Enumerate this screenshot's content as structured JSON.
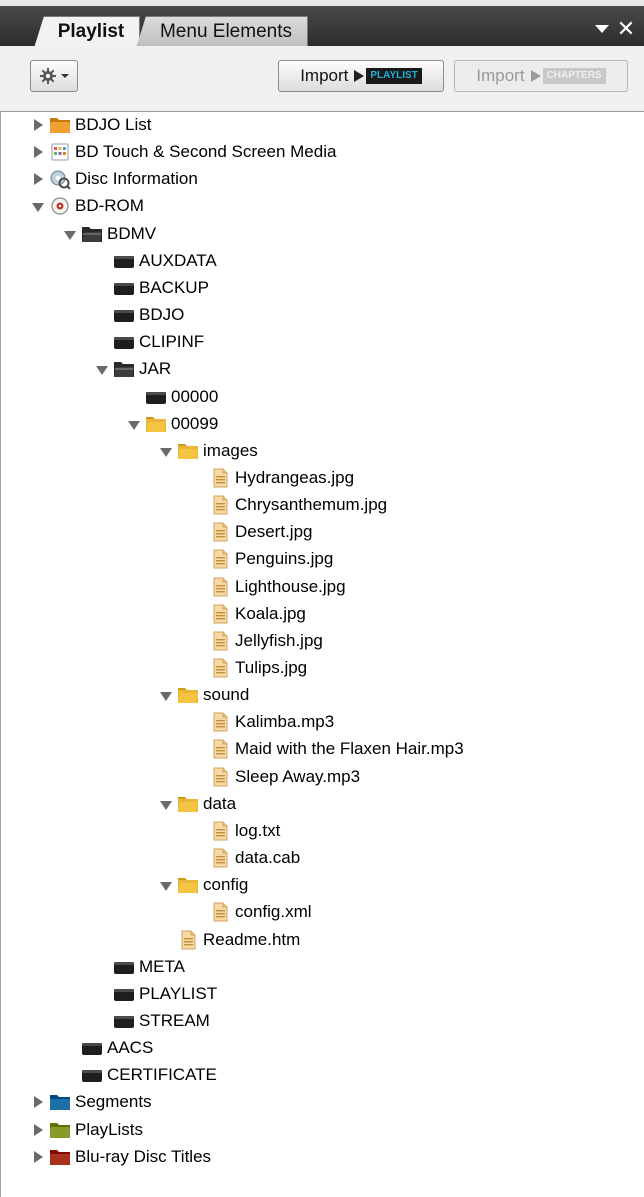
{
  "tabs": [
    {
      "label": "Playlist",
      "active": true
    },
    {
      "label": "Menu Elements",
      "active": false
    }
  ],
  "toolbar": {
    "settings_icon": "gear-icon",
    "import_label": "Import",
    "playlist_badge": "PLAYLIST",
    "chapters_badge": "CHAPTERS"
  },
  "colors": {
    "tabbar": "#2c2c2c",
    "folder_yellow": "#f5c542",
    "bdjo_orange": "#f0a030",
    "segments_blue": "#1d6fa8",
    "playlists_green": "#8a9a2a",
    "titles_red": "#a8321d",
    "playlist_badge_text": "#1fb0d8"
  },
  "tree": [
    {
      "label": "BDJO List",
      "level": 0,
      "state": "collapsed",
      "icon": "bdjo-folder-icon"
    },
    {
      "label": "BD Touch & Second Screen Media",
      "level": 0,
      "state": "collapsed",
      "icon": "touch-media-icon"
    },
    {
      "label": "Disc Information",
      "level": 0,
      "state": "collapsed",
      "icon": "disc-info-icon"
    },
    {
      "label": "BD-ROM",
      "level": 0,
      "state": "expanded",
      "icon": "disc-icon"
    },
    {
      "label": "BDMV",
      "level": 1,
      "state": "expanded",
      "icon": "dark-folder-open-icon"
    },
    {
      "label": "AUXDATA",
      "level": 2,
      "state": "none",
      "icon": "dark-folder-icon"
    },
    {
      "label": "BACKUP",
      "level": 2,
      "state": "none",
      "icon": "dark-folder-icon"
    },
    {
      "label": "BDJO",
      "level": 2,
      "state": "none",
      "icon": "dark-folder-icon"
    },
    {
      "label": "CLIPINF",
      "level": 2,
      "state": "none",
      "icon": "dark-folder-icon"
    },
    {
      "label": "JAR",
      "level": 2,
      "state": "expanded",
      "icon": "dark-folder-open-icon"
    },
    {
      "label": "00000",
      "level": 3,
      "state": "none",
      "icon": "dark-folder-icon"
    },
    {
      "label": "00099",
      "level": 3,
      "state": "expanded",
      "icon": "folder-open-icon"
    },
    {
      "label": "images",
      "level": 4,
      "state": "expanded",
      "icon": "folder-open-icon"
    },
    {
      "label": "Hydrangeas.jpg",
      "level": 5,
      "state": "none",
      "icon": "file-icon"
    },
    {
      "label": "Chrysanthemum.jpg",
      "level": 5,
      "state": "none",
      "icon": "file-icon"
    },
    {
      "label": "Desert.jpg",
      "level": 5,
      "state": "none",
      "icon": "file-icon"
    },
    {
      "label": "Penguins.jpg",
      "level": 5,
      "state": "none",
      "icon": "file-icon"
    },
    {
      "label": "Lighthouse.jpg",
      "level": 5,
      "state": "none",
      "icon": "file-icon"
    },
    {
      "label": "Koala.jpg",
      "level": 5,
      "state": "none",
      "icon": "file-icon"
    },
    {
      "label": "Jellyfish.jpg",
      "level": 5,
      "state": "none",
      "icon": "file-icon"
    },
    {
      "label": "Tulips.jpg",
      "level": 5,
      "state": "none",
      "icon": "file-icon"
    },
    {
      "label": "sound",
      "level": 4,
      "state": "expanded",
      "icon": "folder-open-icon"
    },
    {
      "label": "Kalimba.mp3",
      "level": 5,
      "state": "none",
      "icon": "file-icon"
    },
    {
      "label": "Maid with the Flaxen Hair.mp3",
      "level": 5,
      "state": "none",
      "icon": "file-icon"
    },
    {
      "label": "Sleep Away.mp3",
      "level": 5,
      "state": "none",
      "icon": "file-icon"
    },
    {
      "label": "data",
      "level": 4,
      "state": "expanded",
      "icon": "folder-open-icon"
    },
    {
      "label": "log.txt",
      "level": 5,
      "state": "none",
      "icon": "file-icon"
    },
    {
      "label": "data.cab",
      "level": 5,
      "state": "none",
      "icon": "file-icon"
    },
    {
      "label": "config",
      "level": 4,
      "state": "expanded",
      "icon": "folder-open-icon"
    },
    {
      "label": "config.xml",
      "level": 5,
      "state": "none",
      "icon": "file-icon"
    },
    {
      "label": "Readme.htm",
      "level": 4,
      "state": "none",
      "icon": "file-icon"
    },
    {
      "label": "META",
      "level": 2,
      "state": "none",
      "icon": "dark-folder-icon"
    },
    {
      "label": "PLAYLIST",
      "level": 2,
      "state": "none",
      "icon": "dark-folder-icon"
    },
    {
      "label": "STREAM",
      "level": 2,
      "state": "none",
      "icon": "dark-folder-icon"
    },
    {
      "label": "AACS",
      "level": 1,
      "state": "none",
      "icon": "dark-folder-icon"
    },
    {
      "label": "CERTIFICATE",
      "level": 1,
      "state": "none",
      "icon": "dark-folder-icon"
    },
    {
      "label": "Segments",
      "level": 0,
      "state": "collapsed",
      "icon": "segments-folder-icon"
    },
    {
      "label": "PlayLists",
      "level": 0,
      "state": "collapsed",
      "icon": "playlists-folder-icon"
    },
    {
      "label": "Blu-ray Disc Titles",
      "level": 0,
      "state": "collapsed",
      "icon": "titles-folder-icon"
    }
  ]
}
